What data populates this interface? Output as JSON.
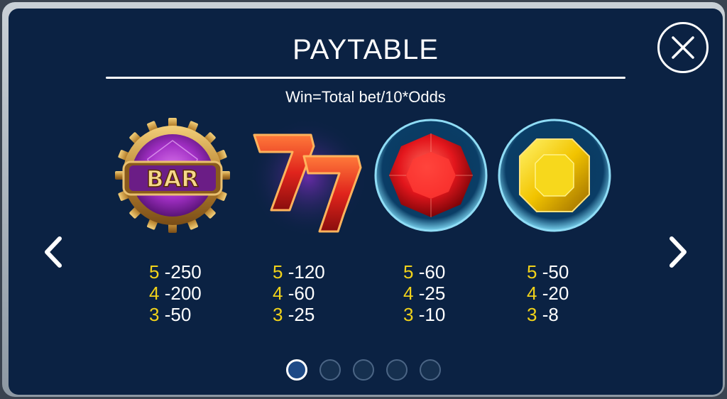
{
  "header": {
    "title": "PAYTABLE",
    "formula": "Win=Total bet/10*Odds"
  },
  "symbols": [
    {
      "icon": "bar-symbol-icon",
      "bar_text": "BAR",
      "payouts": [
        {
          "count": "5",
          "value": "250"
        },
        {
          "count": "4",
          "value": "200"
        },
        {
          "count": "3",
          "value": "50"
        }
      ]
    },
    {
      "icon": "double-seven-symbol-icon",
      "payouts": [
        {
          "count": "5",
          "value": "120"
        },
        {
          "count": "4",
          "value": "60"
        },
        {
          "count": "3",
          "value": "25"
        }
      ]
    },
    {
      "icon": "red-gem-symbol-icon",
      "payouts": [
        {
          "count": "5",
          "value": "60"
        },
        {
          "count": "4",
          "value": "25"
        },
        {
          "count": "3",
          "value": "10"
        }
      ]
    },
    {
      "icon": "yellow-gem-symbol-icon",
      "payouts": [
        {
          "count": "5",
          "value": "50"
        },
        {
          "count": "4",
          "value": "20"
        },
        {
          "count": "3",
          "value": "8"
        }
      ]
    }
  ],
  "separator": "-",
  "pagination": {
    "total_pages": 5,
    "current_page": 1
  },
  "colors": {
    "panel_bg": "#0b2243",
    "count_highlight": "#f1d21a",
    "text": "#ffffff",
    "active_dot": "#1e4a86"
  }
}
